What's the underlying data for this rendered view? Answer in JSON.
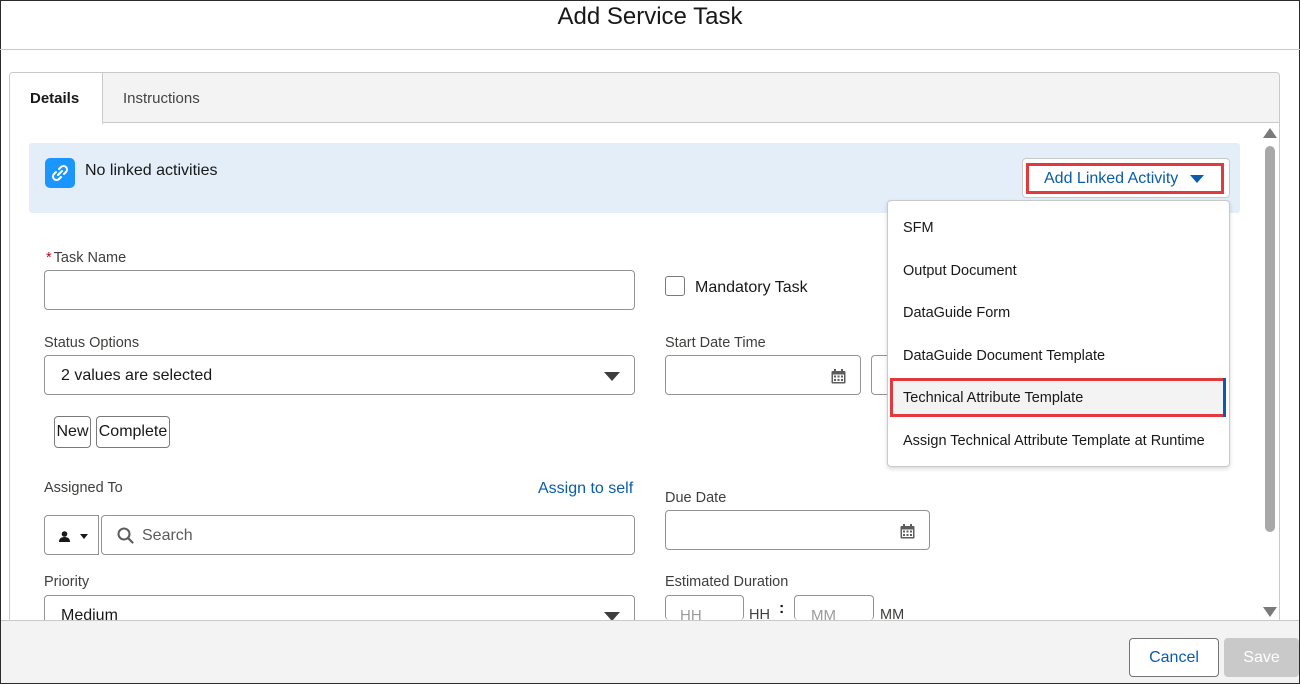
{
  "modal": {
    "title": "Add Service Task"
  },
  "tabs": [
    {
      "label": "Details"
    },
    {
      "label": "Instructions"
    }
  ],
  "linked": {
    "status_text": "No linked activities",
    "add_button_label": "Add Linked Activity",
    "menu_items": [
      {
        "label": "SFM"
      },
      {
        "label": "Output Document"
      },
      {
        "label": "DataGuide Form"
      },
      {
        "label": "DataGuide Document Template"
      },
      {
        "label": "Technical Attribute Template"
      },
      {
        "label": "Assign Technical Attribute Template at Runtime"
      }
    ]
  },
  "form": {
    "task_name_label": "Task Name",
    "task_name_required": "*",
    "mandatory_task_label": "Mandatory Task",
    "status_options_label": "Status Options",
    "status_options_value": "2 values are selected",
    "status_pills": [
      {
        "label": "New"
      },
      {
        "label": "Complete"
      }
    ],
    "start_datetime_label": "Start Date Time",
    "assigned_to_label": "Assigned To",
    "assign_to_self_label": "Assign to self",
    "search_placeholder": "Search",
    "due_date_label": "Due Date",
    "priority_label": "Priority",
    "priority_value": "Medium",
    "estimated_duration_label": "Estimated Duration",
    "hours_placeholder": "HH",
    "hours_unit": "HH",
    "minutes_placeholder": "MM",
    "minutes_unit": "MM",
    "duration_separator": ":"
  },
  "footer": {
    "cancel_label": "Cancel",
    "save_label": "Save"
  },
  "colors": {
    "accent": "#0b5cab",
    "highlight": "#e03a3e",
    "link_icon_bg": "#1b96ff",
    "banner_bg": "#e3eef8"
  }
}
